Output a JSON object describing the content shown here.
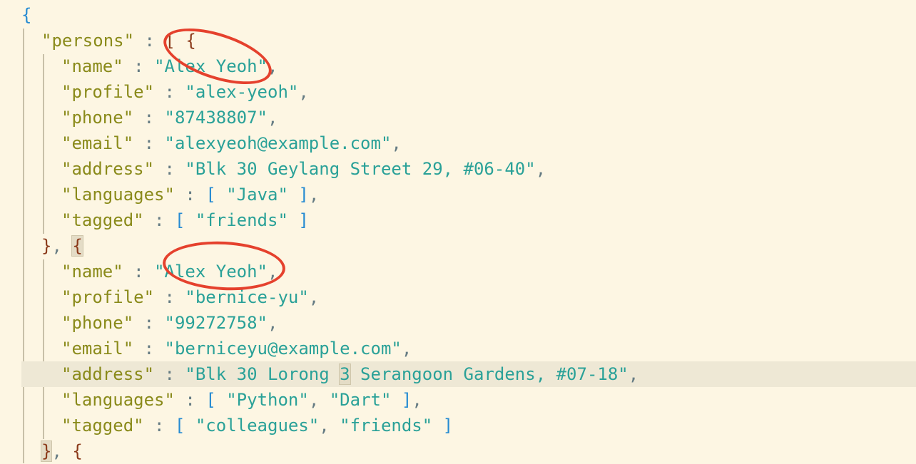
{
  "editor": {
    "lines": [
      {
        "parts": [
          {
            "t": "{",
            "c": "brace-root"
          }
        ]
      },
      {
        "parts": [
          {
            "t": "\"persons\"",
            "c": "key"
          },
          {
            "t": " : ",
            "c": "punct"
          },
          {
            "t": "[",
            "c": "brace"
          },
          {
            "t": " ",
            "c": "punct"
          },
          {
            "t": "{",
            "c": "brace"
          }
        ]
      },
      {
        "parts": [
          {
            "t": "\"name\"",
            "c": "key"
          },
          {
            "t": " : ",
            "c": "punct"
          },
          {
            "t": "\"Alex Yeoh\"",
            "c": "str"
          },
          {
            "t": ",",
            "c": "punct"
          }
        ]
      },
      {
        "parts": [
          {
            "t": "\"profile\"",
            "c": "key"
          },
          {
            "t": " : ",
            "c": "punct"
          },
          {
            "t": "\"alex-yeoh\"",
            "c": "str"
          },
          {
            "t": ",",
            "c": "punct"
          }
        ]
      },
      {
        "parts": [
          {
            "t": "\"phone\"",
            "c": "key"
          },
          {
            "t": " : ",
            "c": "punct"
          },
          {
            "t": "\"87438807\"",
            "c": "str"
          },
          {
            "t": ",",
            "c": "punct"
          }
        ]
      },
      {
        "parts": [
          {
            "t": "\"email\"",
            "c": "key"
          },
          {
            "t": " : ",
            "c": "punct"
          },
          {
            "t": "\"alexyeoh@example.com\"",
            "c": "str"
          },
          {
            "t": ",",
            "c": "punct"
          }
        ]
      },
      {
        "parts": [
          {
            "t": "\"address\"",
            "c": "key"
          },
          {
            "t": " : ",
            "c": "punct"
          },
          {
            "t": "\"Blk 30 Geylang Street 29, #06-40\"",
            "c": "str"
          },
          {
            "t": ",",
            "c": "punct"
          }
        ]
      },
      {
        "parts": [
          {
            "t": "\"languages\"",
            "c": "key"
          },
          {
            "t": " : ",
            "c": "punct"
          },
          {
            "t": "[",
            "c": "bracket"
          },
          {
            "t": " ",
            "c": "punct"
          },
          {
            "t": "\"Java\"",
            "c": "str"
          },
          {
            "t": " ",
            "c": "punct"
          },
          {
            "t": "]",
            "c": "bracket"
          },
          {
            "t": ",",
            "c": "punct"
          }
        ]
      },
      {
        "parts": [
          {
            "t": "\"tagged\"",
            "c": "key"
          },
          {
            "t": " : ",
            "c": "punct"
          },
          {
            "t": "[",
            "c": "bracket"
          },
          {
            "t": " ",
            "c": "punct"
          },
          {
            "t": "\"friends\"",
            "c": "str"
          },
          {
            "t": " ",
            "c": "punct"
          },
          {
            "t": "]",
            "c": "bracket"
          }
        ]
      },
      {
        "parts": [
          {
            "t": "}",
            "c": "brace"
          },
          {
            "t": ", ",
            "c": "punct"
          },
          {
            "t": "{",
            "c": "brace match"
          }
        ]
      },
      {
        "parts": [
          {
            "t": "\"name\"",
            "c": "key"
          },
          {
            "t": " : ",
            "c": "punct"
          },
          {
            "t": "\"Alex Yeoh\"",
            "c": "str"
          },
          {
            "t": ",",
            "c": "punct"
          }
        ]
      },
      {
        "parts": [
          {
            "t": "\"profile\"",
            "c": "key"
          },
          {
            "t": " : ",
            "c": "punct"
          },
          {
            "t": "\"bernice-yu\"",
            "c": "str"
          },
          {
            "t": ",",
            "c": "punct"
          }
        ]
      },
      {
        "parts": [
          {
            "t": "\"phone\"",
            "c": "key"
          },
          {
            "t": " : ",
            "c": "punct"
          },
          {
            "t": "\"99272758\"",
            "c": "str"
          },
          {
            "t": ",",
            "c": "punct"
          }
        ]
      },
      {
        "parts": [
          {
            "t": "\"email\"",
            "c": "key"
          },
          {
            "t": " : ",
            "c": "punct"
          },
          {
            "t": "\"berniceyu@example.com\"",
            "c": "str"
          },
          {
            "t": ",",
            "c": "punct"
          }
        ]
      },
      {
        "parts": [
          {
            "t": "\"address\"",
            "c": "key"
          },
          {
            "t": " : ",
            "c": "punct"
          },
          {
            "t": "\"Blk 30 Lorong ",
            "c": "str"
          },
          {
            "t": "3",
            "c": "str match"
          },
          {
            "t": " Serangoon Gardens, #07-18\"",
            "c": "str"
          },
          {
            "t": ",",
            "c": "punct"
          }
        ]
      },
      {
        "parts": [
          {
            "t": "\"languages\"",
            "c": "key"
          },
          {
            "t": " : ",
            "c": "punct"
          },
          {
            "t": "[",
            "c": "bracket"
          },
          {
            "t": " ",
            "c": "punct"
          },
          {
            "t": "\"Python\"",
            "c": "str"
          },
          {
            "t": ", ",
            "c": "punct"
          },
          {
            "t": "\"Dart\"",
            "c": "str"
          },
          {
            "t": " ",
            "c": "punct"
          },
          {
            "t": "]",
            "c": "bracket"
          },
          {
            "t": ",",
            "c": "punct"
          }
        ]
      },
      {
        "parts": [
          {
            "t": "\"tagged\"",
            "c": "key"
          },
          {
            "t": " : ",
            "c": "punct"
          },
          {
            "t": "[",
            "c": "bracket"
          },
          {
            "t": " ",
            "c": "punct"
          },
          {
            "t": "\"colleagues\"",
            "c": "str"
          },
          {
            "t": ", ",
            "c": "punct"
          },
          {
            "t": "\"friends\"",
            "c": "str"
          },
          {
            "t": " ",
            "c": "punct"
          },
          {
            "t": "]",
            "c": "bracket"
          }
        ]
      },
      {
        "parts": [
          {
            "t": "}",
            "c": "brace match"
          },
          {
            "t": ", ",
            "c": "punct"
          },
          {
            "t": "{",
            "c": "brace"
          }
        ]
      }
    ],
    "current_line": 14
  },
  "colors": {
    "background": "#fdf6e3",
    "key": "#8a8a1a",
    "string": "#2aa198",
    "bracket": "#268bd2",
    "brace": "#8b3a1a",
    "annotation": "#e5412d",
    "current_line": "#eee8d5"
  }
}
